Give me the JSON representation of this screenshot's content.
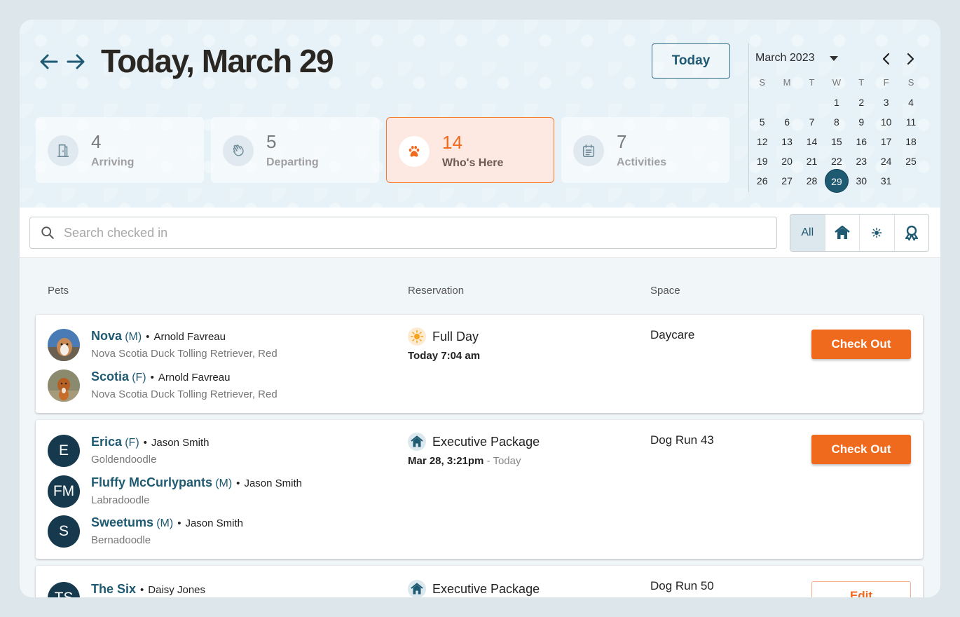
{
  "header": {
    "title": "Today, March 29",
    "today_button": "Today"
  },
  "stats": [
    {
      "count": "4",
      "label": "Arriving",
      "icon": "door-icon"
    },
    {
      "count": "5",
      "label": "Departing",
      "icon": "waving-hand-icon"
    },
    {
      "count": "14",
      "label": "Who's Here",
      "icon": "paw-icon",
      "active": true
    },
    {
      "count": "7",
      "label": "Activities",
      "icon": "calendar-list-icon"
    }
  ],
  "calendar": {
    "month_label": "March 2023",
    "weekdays": [
      "S",
      "M",
      "T",
      "W",
      "T",
      "F",
      "S"
    ],
    "weeks": [
      [
        "",
        "",
        "",
        "1",
        "2",
        "3",
        "4"
      ],
      [
        "5",
        "6",
        "7",
        "8",
        "9",
        "10",
        "11"
      ],
      [
        "12",
        "13",
        "14",
        "15",
        "16",
        "17",
        "18"
      ],
      [
        "19",
        "20",
        "21",
        "22",
        "23",
        "24",
        "25"
      ],
      [
        "26",
        "27",
        "28",
        "29",
        "30",
        "31",
        ""
      ]
    ],
    "selected_day": "29"
  },
  "search": {
    "placeholder": "Search checked in",
    "value": ""
  },
  "filters": {
    "all_label": "All",
    "icons": [
      "house-icon",
      "sun-icon",
      "ribbon-icon"
    ]
  },
  "columns": {
    "pets": "Pets",
    "reservation": "Reservation",
    "space": "Space"
  },
  "colors": {
    "brand": "#1f5a73",
    "accent": "#f06a1e"
  },
  "reservations": [
    {
      "pets": [
        {
          "name": "Nova",
          "sex": "(M)",
          "owner": "Arnold Favreau",
          "breed": "Nova Scotia Duck Tolling Retriever, Red",
          "avatar": "photo"
        },
        {
          "name": "Scotia",
          "sex": "(F)",
          "owner": "Arnold Favreau",
          "breed": "Nova Scotia Duck Tolling Retriever, Red",
          "avatar": "photo"
        }
      ],
      "type": "Full Day",
      "type_icon": "sun-icon",
      "time": "Today 7:04 am",
      "time_suffix": "",
      "space": "Daycare",
      "action": "Check Out"
    },
    {
      "pets": [
        {
          "name": "Erica",
          "sex": "(F)",
          "owner": "Jason Smith",
          "breed": "Goldendoodle",
          "initials": "E"
        },
        {
          "name": "Fluffy McCurlypants",
          "sex": "(M)",
          "owner": "Jason Smith",
          "breed": "Labradoodle",
          "initials": "FM"
        },
        {
          "name": "Sweetums",
          "sex": "(M)",
          "owner": "Jason Smith",
          "breed": "Bernadoodle",
          "initials": "S"
        }
      ],
      "type": "Executive Package",
      "type_icon": "house-icon",
      "time": "Mar 28, 3:21pm",
      "time_suffix": "- Today",
      "space": "Dog Run 43",
      "action": "Check Out"
    },
    {
      "pets": [
        {
          "name": "The Six",
          "sex": "",
          "owner": "Daisy Jones",
          "breed": "",
          "initials": "TS"
        }
      ],
      "type": "Executive Package",
      "type_icon": "house-icon",
      "time": "",
      "time_suffix": "",
      "space": "Dog Run 50",
      "action": "Edit"
    }
  ]
}
